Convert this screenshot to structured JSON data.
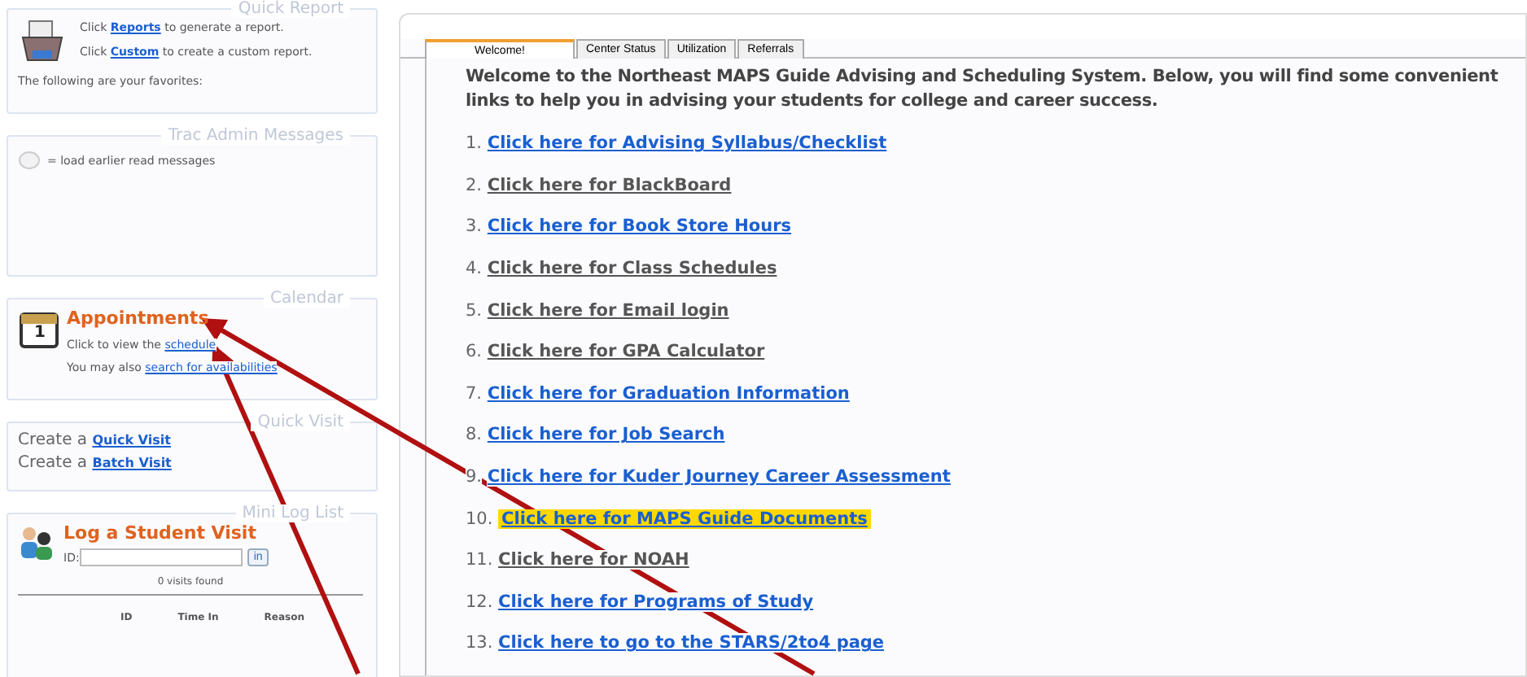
{
  "quick_report": {
    "title": "Quick Report",
    "lines": [
      {
        "before": "Click ",
        "link": "Reports",
        "after": " to generate a report."
      },
      {
        "before": "Click ",
        "link": "Custom",
        "after": " to create a custom report."
      }
    ],
    "favorites": "The following are your favorites:"
  },
  "admin_messages": {
    "title": "Trac Admin Messages",
    "note": "= load earlier read messages"
  },
  "calendar": {
    "title": "Calendar",
    "icon_day": "1",
    "heading": "Appointments",
    "lines": [
      {
        "before": "Click to view the ",
        "link": "schedule",
        "after": "."
      },
      {
        "before": "You may also ",
        "link": "search for availabilities"
      }
    ]
  },
  "quick_visit": {
    "title": "Quick Visit",
    "lines": [
      {
        "before": "Create a ",
        "link": "Quick Visit"
      },
      {
        "before": "Create a ",
        "link": "Batch Visit"
      }
    ]
  },
  "mini_log": {
    "title": "Mini Log List",
    "heading": "Log a Student Visit",
    "id_label": "ID:",
    "button": "in",
    "count": "0 visits found",
    "columns": [
      "ID",
      "Time In",
      "Reason"
    ]
  },
  "tabs": [
    {
      "label": "Welcome!",
      "selected": true
    },
    {
      "label": "Center Status",
      "selected": false
    },
    {
      "label": "Utilization",
      "selected": false
    },
    {
      "label": "Referrals",
      "selected": false
    }
  ],
  "welcome": "Welcome to the Northeast MAPS Guide Advising and Scheduling System. Below, you will find some convenient links to help you in advising your students for college and career success.",
  "links": [
    {
      "number": "1.",
      "text": "Click here for Advising Syllabus/Checklist",
      "visited": false,
      "highlighted": false
    },
    {
      "number": "2.",
      "text": "Click here for BlackBoard",
      "visited": true,
      "highlighted": false
    },
    {
      "number": "3.",
      "text": "Click here for Book Store Hours",
      "visited": false,
      "highlighted": false
    },
    {
      "number": "4.",
      "text": "Click here for Class Schedules",
      "visited": true,
      "highlighted": false
    },
    {
      "number": "5.",
      "text": "Click here for Email login",
      "visited": true,
      "highlighted": false
    },
    {
      "number": "6.",
      "text": "Click here for GPA Calculator",
      "visited": true,
      "highlighted": false
    },
    {
      "number": "7.",
      "text": "Click here for Graduation Information",
      "visited": false,
      "highlighted": false
    },
    {
      "number": "8.",
      "text": "Click here for Job Search",
      "visited": false,
      "highlighted": false
    },
    {
      "number": "9.",
      "text": "Click here for Kuder Journey Career Assessment",
      "visited": false,
      "highlighted": false
    },
    {
      "number": "10.",
      "text": "Click here for MAPS Guide Documents",
      "visited": false,
      "highlighted": true
    },
    {
      "number": "11.",
      "text": "Click here for NOAH",
      "visited": true,
      "highlighted": false
    },
    {
      "number": "12.",
      "text": "Click here for Programs of Study",
      "visited": false,
      "highlighted": false
    },
    {
      "number": "13.",
      "text": "Click here to go to the STARS/2to4 page",
      "visited": false,
      "highlighted": false
    }
  ]
}
